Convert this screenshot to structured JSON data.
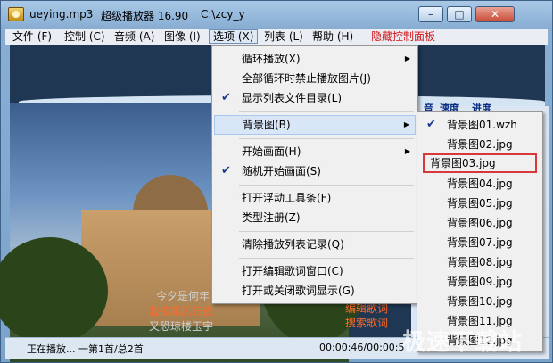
{
  "title": {
    "filename": "ueying.mp3",
    "app_name": "超级播放器 16.90",
    "path": "C:\\zcy_y",
    "minimize": "–",
    "maximize": "□",
    "close": "✕"
  },
  "menubar": {
    "file": "文件 (F)",
    "control": "控制 (C)",
    "audio": "音频 (A)",
    "image": "图像 (I)",
    "options": "选项 (X)",
    "list": "列表 (L)",
    "help": "帮助 (H)",
    "hide_panel": "隐藏控制面板"
  },
  "options_menu": {
    "items": [
      {
        "label": "循环播放(X)",
        "submenu": true,
        "checked": false
      },
      {
        "label": "全部循环时禁止播放图片(J)",
        "submenu": false,
        "checked": false
      },
      {
        "label": "显示列表文件目录(L)",
        "submenu": false,
        "checked": true
      },
      {
        "label": "背景图(B)",
        "submenu": true,
        "checked": false
      },
      {
        "label": "开始画面(H)",
        "submenu": true,
        "checked": false
      },
      {
        "label": "随机开始画面(S)",
        "submenu": false,
        "checked": true
      },
      {
        "label": "打开浮动工具条(F)",
        "submenu": false,
        "checked": false
      },
      {
        "label": "类型注册(Z)",
        "submenu": false,
        "checked": false
      },
      {
        "label": "清除播放列表记录(Q)",
        "submenu": false,
        "checked": false
      },
      {
        "label": "打开编辑歌词窗口(C)",
        "submenu": false,
        "checked": false
      },
      {
        "label": "打开或关闭歌词显示(G)",
        "submenu": false,
        "checked": false
      }
    ]
  },
  "background_submenu": {
    "items": [
      {
        "label": "背景图01.wzh",
        "checked": true
      },
      {
        "label": "背景图02.jpg",
        "checked": false
      },
      {
        "label": "背景图03.jpg",
        "checked": false
      },
      {
        "label": "背景图04.jpg",
        "checked": false
      },
      {
        "label": "背景图05.jpg",
        "checked": false
      },
      {
        "label": "背景图06.jpg",
        "checked": false
      },
      {
        "label": "背景图07.jpg",
        "checked": false
      },
      {
        "label": "背景图08.jpg",
        "checked": false
      },
      {
        "label": "背景图09.jpg",
        "checked": false
      },
      {
        "label": "背景图10.jpg",
        "checked": false
      },
      {
        "label": "背景图11.jpg",
        "checked": false
      },
      {
        "label": "背景图12.jpg",
        "checked": false
      }
    ]
  },
  "side_header": {
    "volume": "音",
    "speed": "速度",
    "progress": "进度"
  },
  "lyrics": {
    "line1": "今夕是何年",
    "line2": "我欲乘风归去",
    "line3": "又恐琼楼玉宇",
    "edit_lyrics": "编辑歌词",
    "search_lyrics": "搜索歌词"
  },
  "status": {
    "playing": "正在播放... 一第1首/总2首",
    "time": "00:00:46/00:00:5"
  },
  "watermark": "极速下载站",
  "colors": {
    "accent_red": "#d0161b",
    "lyric_highlight": "#ff6a2a",
    "check_blue": "#1d3a8a"
  }
}
